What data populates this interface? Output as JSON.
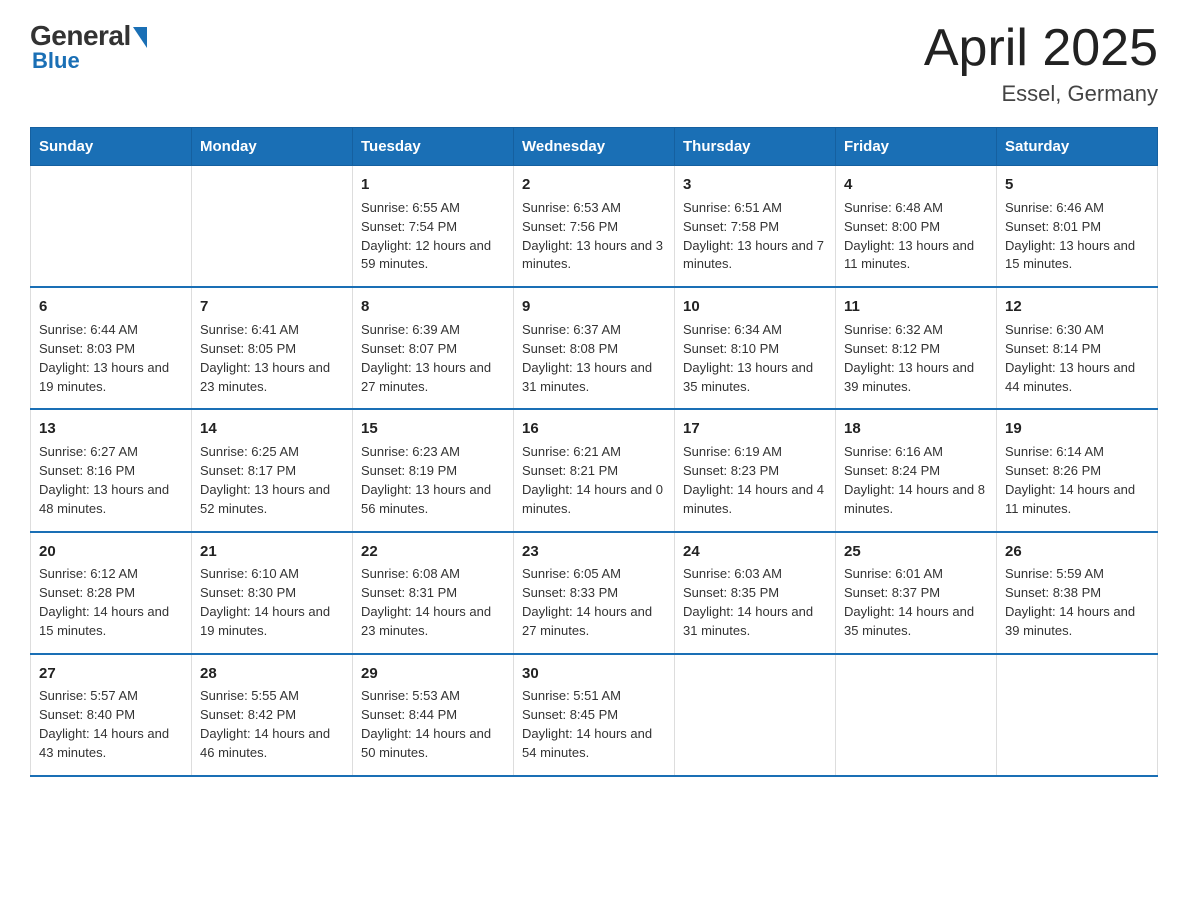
{
  "header": {
    "logo_general": "General",
    "logo_blue": "Blue",
    "title": "April 2025",
    "subtitle": "Essel, Germany"
  },
  "weekdays": [
    "Sunday",
    "Monday",
    "Tuesday",
    "Wednesday",
    "Thursday",
    "Friday",
    "Saturday"
  ],
  "weeks": [
    [
      {
        "empty": true
      },
      {
        "empty": true
      },
      {
        "day": "1",
        "sunrise": "6:55 AM",
        "sunset": "7:54 PM",
        "daylight": "12 hours and 59 minutes."
      },
      {
        "day": "2",
        "sunrise": "6:53 AM",
        "sunset": "7:56 PM",
        "daylight": "13 hours and 3 minutes."
      },
      {
        "day": "3",
        "sunrise": "6:51 AM",
        "sunset": "7:58 PM",
        "daylight": "13 hours and 7 minutes."
      },
      {
        "day": "4",
        "sunrise": "6:48 AM",
        "sunset": "8:00 PM",
        "daylight": "13 hours and 11 minutes."
      },
      {
        "day": "5",
        "sunrise": "6:46 AM",
        "sunset": "8:01 PM",
        "daylight": "13 hours and 15 minutes."
      }
    ],
    [
      {
        "day": "6",
        "sunrise": "6:44 AM",
        "sunset": "8:03 PM",
        "daylight": "13 hours and 19 minutes."
      },
      {
        "day": "7",
        "sunrise": "6:41 AM",
        "sunset": "8:05 PM",
        "daylight": "13 hours and 23 minutes."
      },
      {
        "day": "8",
        "sunrise": "6:39 AM",
        "sunset": "8:07 PM",
        "daylight": "13 hours and 27 minutes."
      },
      {
        "day": "9",
        "sunrise": "6:37 AM",
        "sunset": "8:08 PM",
        "daylight": "13 hours and 31 minutes."
      },
      {
        "day": "10",
        "sunrise": "6:34 AM",
        "sunset": "8:10 PM",
        "daylight": "13 hours and 35 minutes."
      },
      {
        "day": "11",
        "sunrise": "6:32 AM",
        "sunset": "8:12 PM",
        "daylight": "13 hours and 39 minutes."
      },
      {
        "day": "12",
        "sunrise": "6:30 AM",
        "sunset": "8:14 PM",
        "daylight": "13 hours and 44 minutes."
      }
    ],
    [
      {
        "day": "13",
        "sunrise": "6:27 AM",
        "sunset": "8:16 PM",
        "daylight": "13 hours and 48 minutes."
      },
      {
        "day": "14",
        "sunrise": "6:25 AM",
        "sunset": "8:17 PM",
        "daylight": "13 hours and 52 minutes."
      },
      {
        "day": "15",
        "sunrise": "6:23 AM",
        "sunset": "8:19 PM",
        "daylight": "13 hours and 56 minutes."
      },
      {
        "day": "16",
        "sunrise": "6:21 AM",
        "sunset": "8:21 PM",
        "daylight": "14 hours and 0 minutes."
      },
      {
        "day": "17",
        "sunrise": "6:19 AM",
        "sunset": "8:23 PM",
        "daylight": "14 hours and 4 minutes."
      },
      {
        "day": "18",
        "sunrise": "6:16 AM",
        "sunset": "8:24 PM",
        "daylight": "14 hours and 8 minutes."
      },
      {
        "day": "19",
        "sunrise": "6:14 AM",
        "sunset": "8:26 PM",
        "daylight": "14 hours and 11 minutes."
      }
    ],
    [
      {
        "day": "20",
        "sunrise": "6:12 AM",
        "sunset": "8:28 PM",
        "daylight": "14 hours and 15 minutes."
      },
      {
        "day": "21",
        "sunrise": "6:10 AM",
        "sunset": "8:30 PM",
        "daylight": "14 hours and 19 minutes."
      },
      {
        "day": "22",
        "sunrise": "6:08 AM",
        "sunset": "8:31 PM",
        "daylight": "14 hours and 23 minutes."
      },
      {
        "day": "23",
        "sunrise": "6:05 AM",
        "sunset": "8:33 PM",
        "daylight": "14 hours and 27 minutes."
      },
      {
        "day": "24",
        "sunrise": "6:03 AM",
        "sunset": "8:35 PM",
        "daylight": "14 hours and 31 minutes."
      },
      {
        "day": "25",
        "sunrise": "6:01 AM",
        "sunset": "8:37 PM",
        "daylight": "14 hours and 35 minutes."
      },
      {
        "day": "26",
        "sunrise": "5:59 AM",
        "sunset": "8:38 PM",
        "daylight": "14 hours and 39 minutes."
      }
    ],
    [
      {
        "day": "27",
        "sunrise": "5:57 AM",
        "sunset": "8:40 PM",
        "daylight": "14 hours and 43 minutes."
      },
      {
        "day": "28",
        "sunrise": "5:55 AM",
        "sunset": "8:42 PM",
        "daylight": "14 hours and 46 minutes."
      },
      {
        "day": "29",
        "sunrise": "5:53 AM",
        "sunset": "8:44 PM",
        "daylight": "14 hours and 50 minutes."
      },
      {
        "day": "30",
        "sunrise": "5:51 AM",
        "sunset": "8:45 PM",
        "daylight": "14 hours and 54 minutes."
      },
      {
        "empty": true
      },
      {
        "empty": true
      },
      {
        "empty": true
      }
    ]
  ],
  "labels": {
    "sunrise": "Sunrise:",
    "sunset": "Sunset:",
    "daylight": "Daylight:"
  }
}
